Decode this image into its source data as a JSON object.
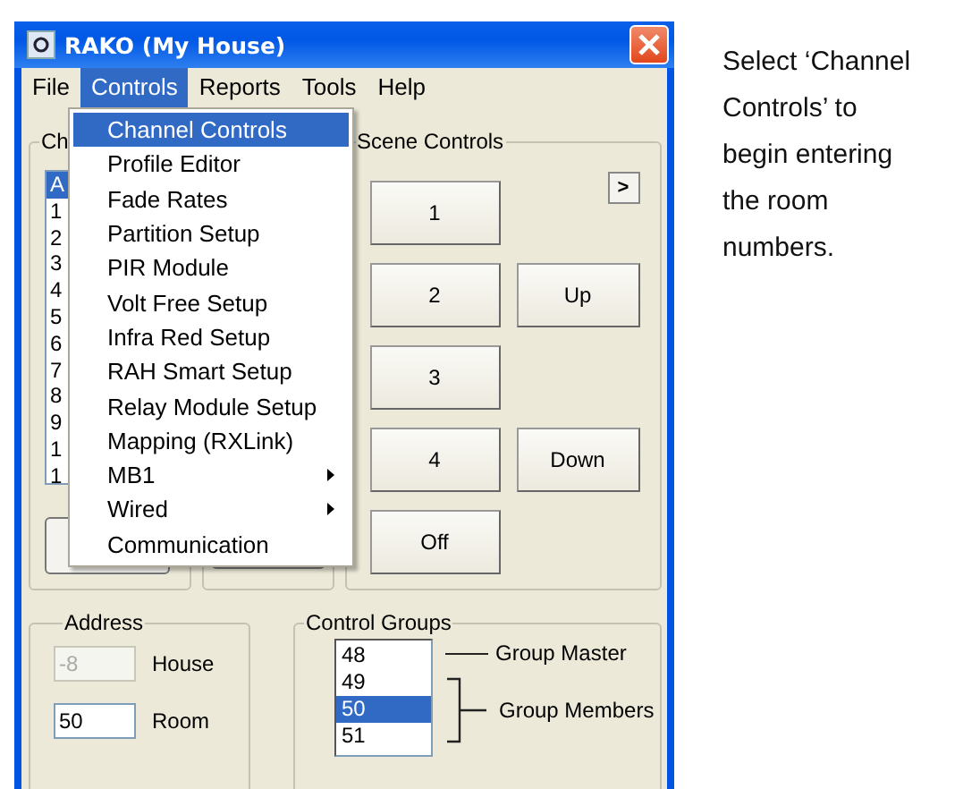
{
  "window": {
    "title": "RAKO (My House)"
  },
  "menu_bar": [
    {
      "label": "File",
      "selected": false
    },
    {
      "label": "Controls",
      "selected": true
    },
    {
      "label": "Reports",
      "selected": false
    },
    {
      "label": "Tools",
      "selected": false
    },
    {
      "label": "Help",
      "selected": false
    }
  ],
  "controls_menu": [
    {
      "label": "Channel Controls",
      "selected": true,
      "submenu": false
    },
    {
      "label": "Profile Editor",
      "selected": false,
      "submenu": false
    },
    {
      "label": "Fade Rates",
      "selected": false,
      "submenu": false
    },
    {
      "label": "Partition Setup",
      "selected": false,
      "submenu": false
    },
    {
      "label": "PIR Module",
      "selected": false,
      "submenu": false
    },
    {
      "label": "Volt Free Setup",
      "selected": false,
      "submenu": false
    },
    {
      "label": "Infra Red Setup",
      "selected": false,
      "submenu": false
    },
    {
      "label": "RAH Smart Setup",
      "selected": false,
      "submenu": false
    },
    {
      "label": "Relay Module Setup",
      "selected": false,
      "submenu": false
    },
    {
      "label": "Mapping (RXLink)",
      "selected": false,
      "submenu": false
    },
    {
      "label": "MB1",
      "selected": false,
      "submenu": true
    },
    {
      "label": "Wired",
      "selected": false,
      "submenu": true
    },
    {
      "label": "Communication",
      "selected": false,
      "submenu": false
    }
  ],
  "channel_group": {
    "title": "Ch",
    "list": [
      {
        "label": "A",
        "selected": true
      },
      {
        "label": "1",
        "selected": false
      },
      {
        "label": "2",
        "selected": false
      },
      {
        "label": "3",
        "selected": false
      },
      {
        "label": "4",
        "selected": false
      },
      {
        "label": "5",
        "selected": false
      },
      {
        "label": "6",
        "selected": false
      },
      {
        "label": "7",
        "selected": false
      },
      {
        "label": "8",
        "selected": false
      },
      {
        "label": "9",
        "selected": false
      },
      {
        "label": "1",
        "selected": false
      },
      {
        "label": "1",
        "selected": false
      }
    ]
  },
  "scene_controls": {
    "title": "Scene Controls",
    "more_button": ">",
    "rows": [
      [
        "1"
      ],
      [
        "2",
        "Up"
      ],
      [
        "3"
      ],
      [
        "4",
        "Down"
      ],
      [
        "Off"
      ]
    ]
  },
  "address": {
    "title": "Address",
    "fields": [
      {
        "label": "House",
        "value": "-8",
        "disabled": true
      },
      {
        "label": "Room",
        "value": "50",
        "disabled": false
      }
    ]
  },
  "control_groups": {
    "title": "Control Groups",
    "list": [
      {
        "label": "48",
        "selected": false
      },
      {
        "label": "49",
        "selected": false
      },
      {
        "label": "50",
        "selected": true
      },
      {
        "label": "51",
        "selected": false
      }
    ],
    "master_label": "Group Master",
    "members_label": "Group Members"
  },
  "instruction": "Select ‘Channel Controls’ to begin entering the room numbers."
}
